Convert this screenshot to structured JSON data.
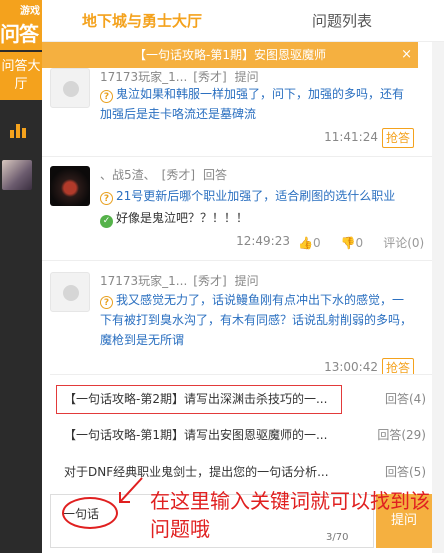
{
  "sidebar": {
    "logo_top": "游戏",
    "logo_bottom": "问答",
    "nav_qa": "问答大厅"
  },
  "tabs": [
    "地下城与勇士大厅",
    "问题列表"
  ],
  "topic_bar": {
    "title": "【一句话攻略-第1期】安图恩驱魔师",
    "close": "×"
  },
  "posts": [
    {
      "user": "17173玩家_1...",
      "role": "[秀才]",
      "action": "提问",
      "question": "鬼泣如果和韩服一样加强了，问下，加强的多吗，还有加强后是走卡咯流还是墓碑流",
      "time": "11:41:24",
      "answer_btn": "抢答"
    },
    {
      "user": "、战5渣、",
      "role": "[秀才]",
      "action": "回答",
      "question": "21号更新后哪个职业加强了，适合刷图的选什么职业",
      "answer": "好像是鬼泣吧？？！！！",
      "time": "12:49:23",
      "up": "0",
      "down": "0",
      "comment": "评论(0)"
    },
    {
      "user": "17173玩家_1...",
      "role": "[秀才]",
      "action": "提问",
      "question": "我又感觉无力了，话说鳗鱼刚有点冲出下水的感觉，一下有被打到臭水沟了，有木有同感？话说乱射削弱的多吗，魔枪到是无所谓",
      "time": "13:00:42",
      "answer_btn": "抢答"
    }
  ],
  "suggestions": [
    {
      "title": "【一句话攻略-第2期】请写出深渊击杀技巧的一...",
      "count": "回答(4)"
    },
    {
      "title": "【一句话攻略-第1期】请写出安图恩驱魔师的一...",
      "count": "回答(29)"
    },
    {
      "title": "对于DNF经典职业鬼剑士，提出您的一句话分析...",
      "count": "回答(5)"
    }
  ],
  "input": {
    "value": "一句话",
    "counter": "3/70",
    "submit": "提问"
  },
  "annotation": "在这里输入关键词就可以找到该问题哦",
  "colors": {
    "accent": "#f4a21d",
    "link": "#2a6fc0",
    "annotation": "#e02020"
  }
}
